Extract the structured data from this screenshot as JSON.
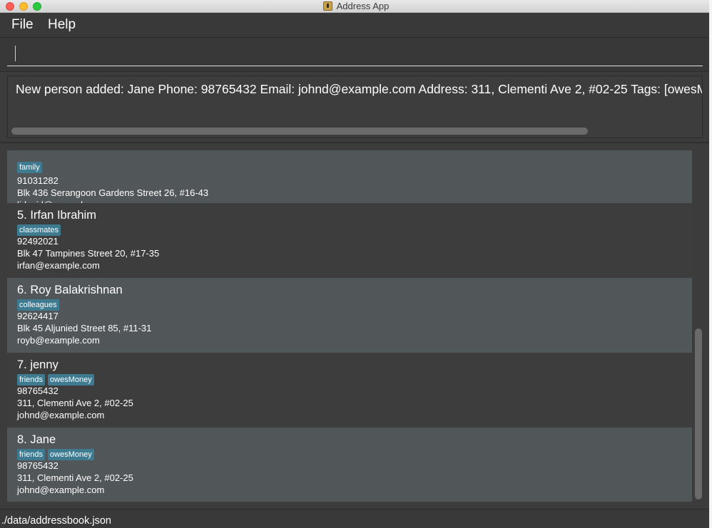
{
  "window": {
    "title": "Address App"
  },
  "menu": {
    "file": "File",
    "help": "Help"
  },
  "command": {
    "value": ""
  },
  "result": {
    "text": "New person added: Jane Phone: 98765432 Email: johnd@example.com Address: 311, Clementi Ave 2, #02-25 Tags: [owesMoney][friends]"
  },
  "persons": [
    {
      "title": "",
      "tags": [
        "family"
      ],
      "phone": "91031282",
      "address": "Blk 436 Serangoon Gardens Street 26, #16-43",
      "email": "lidavid@example.com"
    },
    {
      "title": "5.  Irfan Ibrahim",
      "tags": [
        "classmates"
      ],
      "phone": "92492021",
      "address": "Blk 47 Tampines Street 20, #17-35",
      "email": "irfan@example.com"
    },
    {
      "title": "6.  Roy Balakrishnan",
      "tags": [
        "colleagues"
      ],
      "phone": "92624417",
      "address": "Blk 45 Aljunied Street 85, #11-31",
      "email": "royb@example.com"
    },
    {
      "title": "7.  jenny",
      "tags": [
        "friends",
        "owesMoney"
      ],
      "phone": "98765432",
      "address": "311, Clementi Ave 2, #02-25",
      "email": "johnd@example.com"
    },
    {
      "title": "8.  Jane",
      "tags": [
        "friends",
        "owesMoney"
      ],
      "phone": "98765432",
      "address": "311, Clementi Ave 2, #02-25",
      "email": "johnd@example.com"
    }
  ],
  "status": {
    "path": "./data/addressbook.json"
  },
  "colors": {
    "tag_bg": "#3e7b91",
    "card_light": "#515658",
    "card_dark": "#3d3d3d",
    "background": "#3c3c3c"
  }
}
